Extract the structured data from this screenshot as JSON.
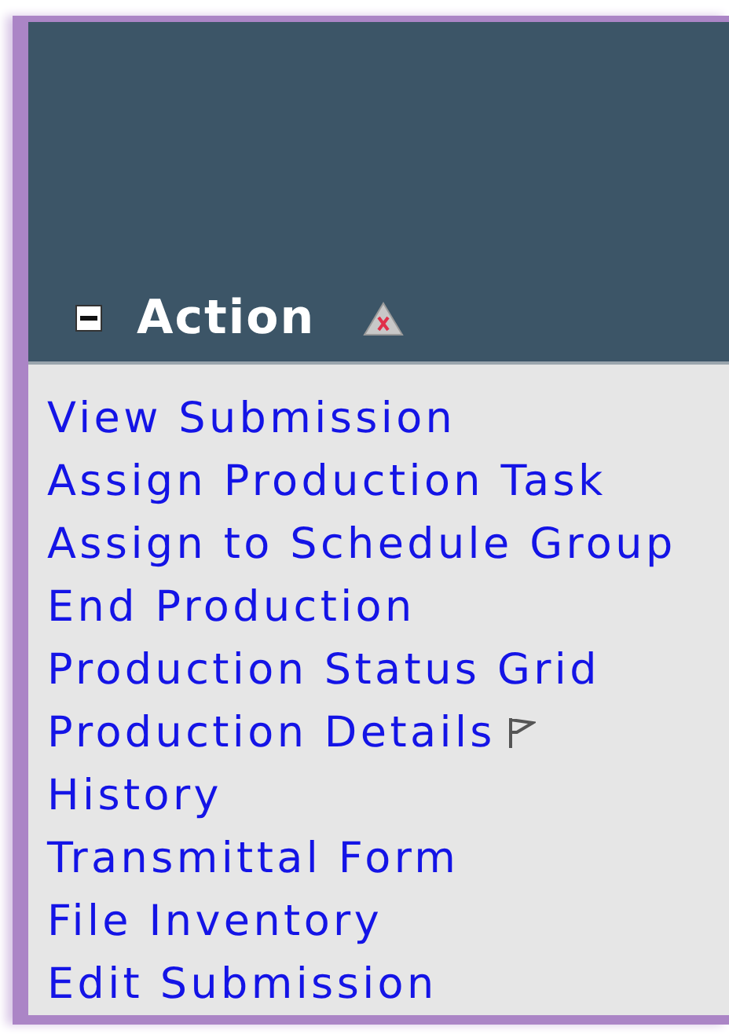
{
  "section": {
    "title": "Action",
    "expanded": true
  },
  "actions": [
    {
      "label": "View Submission",
      "flagged": false
    },
    {
      "label": "Assign Production Task",
      "flagged": false
    },
    {
      "label": "Assign to Schedule Group",
      "flagged": false
    },
    {
      "label": "End Production",
      "flagged": false
    },
    {
      "label": "Production Status Grid",
      "flagged": false
    },
    {
      "label": "Production Details",
      "flagged": true
    },
    {
      "label": "History",
      "flagged": false
    },
    {
      "label": "Transmittal Form",
      "flagged": false
    },
    {
      "label": "File Inventory",
      "flagged": false
    },
    {
      "label": "Edit Submission",
      "flagged": false
    }
  ]
}
